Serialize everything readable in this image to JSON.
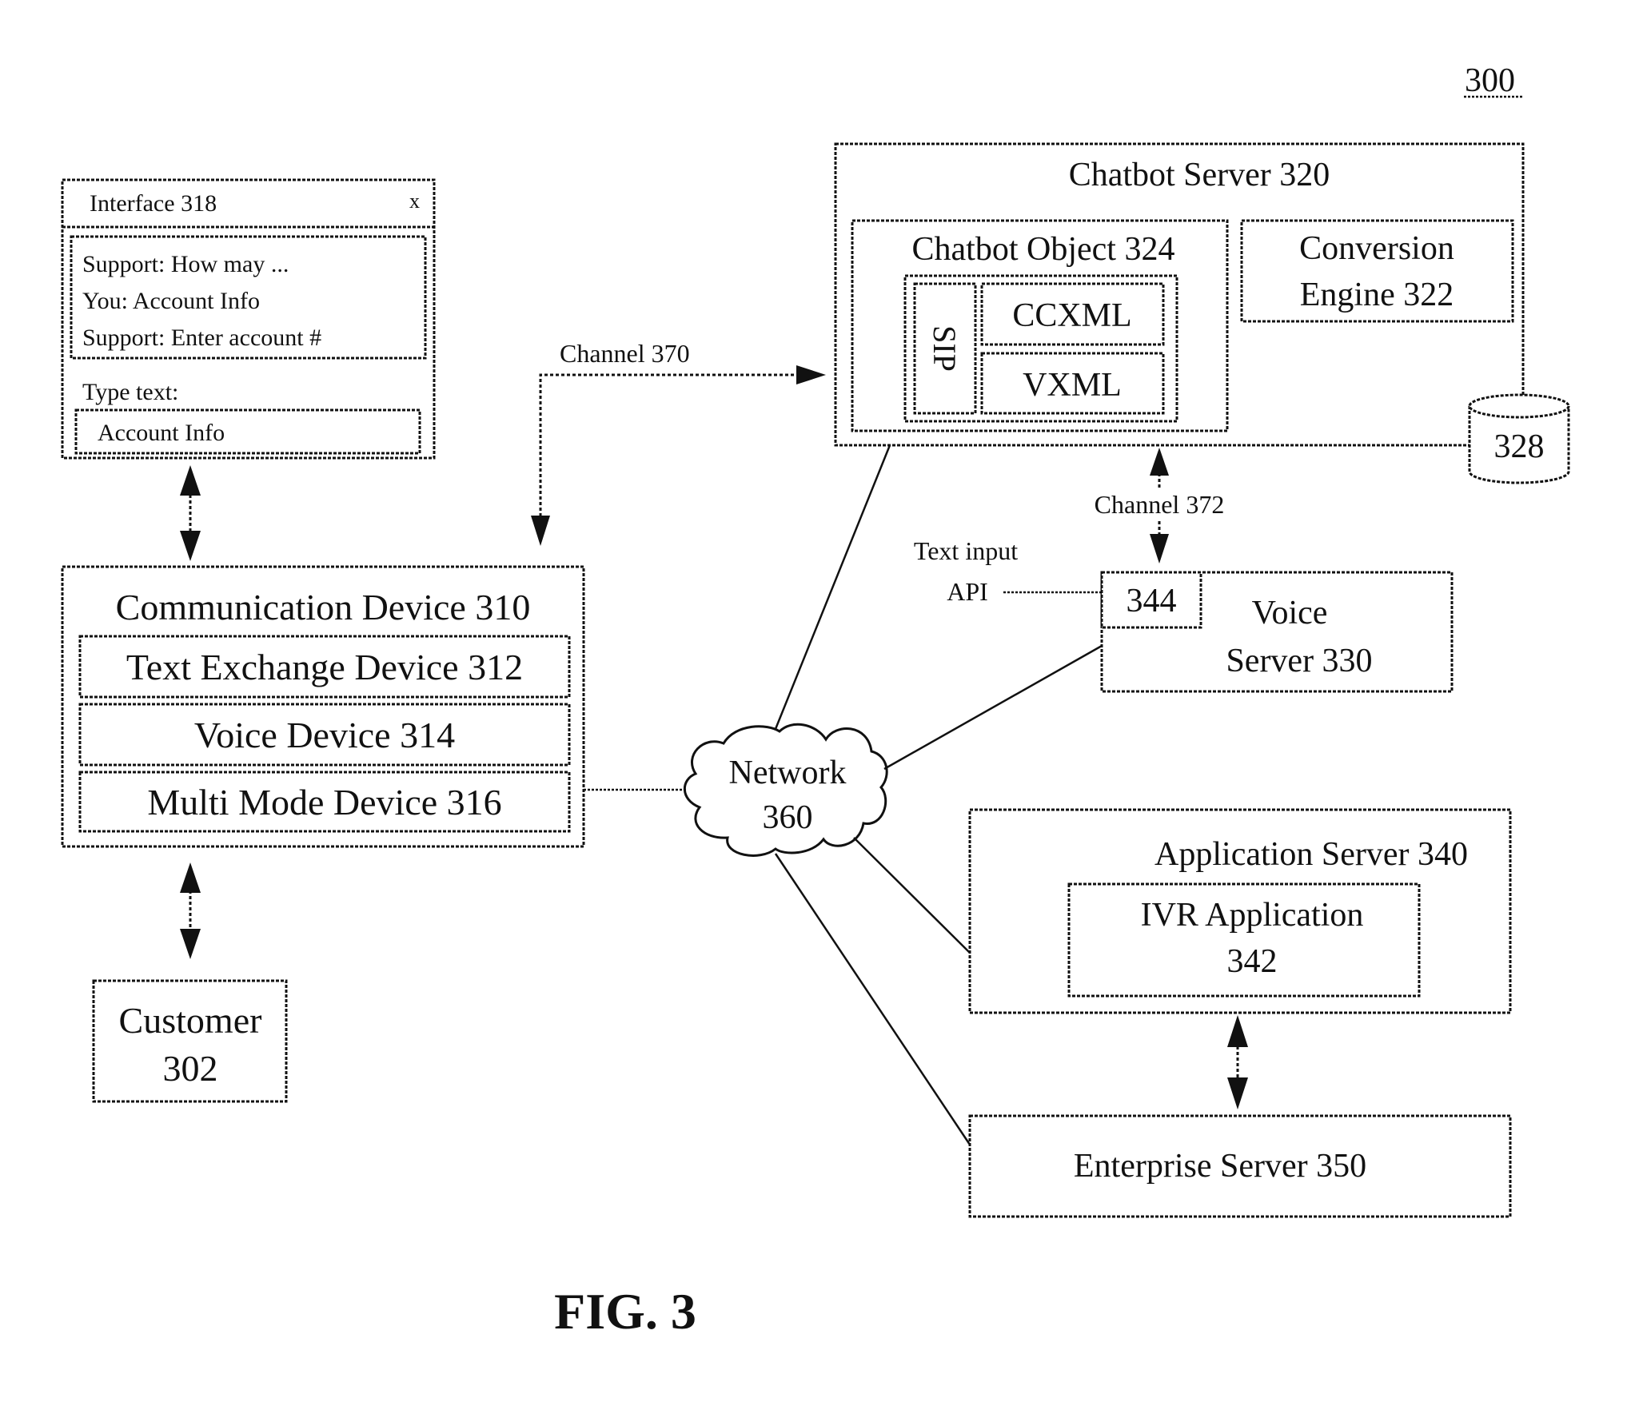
{
  "figure": {
    "label": "FIG. 3",
    "reference": "300"
  },
  "interface": {
    "title": "Interface 318",
    "close_glyph": "x",
    "chat_lines": [
      "Support: How may ...",
      "You: Account Info",
      "Support: Enter account #"
    ],
    "input_label": "Type text:",
    "input_value": "Account Info"
  },
  "communication_device": {
    "title": "Communication Device 310",
    "components": [
      "Text Exchange Device 312",
      "Voice Device 314",
      "Multi Mode Device 316"
    ]
  },
  "customer": {
    "line1": "Customer",
    "line2": "302"
  },
  "chatbot_server": {
    "title": "Chatbot Server 320",
    "chatbot_object": {
      "title": "Chatbot Object 324",
      "sip": "SIP",
      "ccxml": "CCXML",
      "vxml": "VXML"
    },
    "conversion_engine": {
      "line1": "Conversion",
      "line2": "Engine 322"
    },
    "database": "328"
  },
  "channels": {
    "channel_370": "Channel 370",
    "channel_372": "Channel 372"
  },
  "voice_server": {
    "api_box": "344",
    "line1": "Voice",
    "line2": "Server 330",
    "api_label_line1": "Text input",
    "api_label_line2": "API"
  },
  "network": {
    "line1": "Network",
    "line2": "360"
  },
  "application_server": {
    "title": "Application Server 340",
    "ivr_line1": "IVR Application",
    "ivr_line2": "342"
  },
  "enterprise_server": {
    "title": "Enterprise Server 350"
  }
}
